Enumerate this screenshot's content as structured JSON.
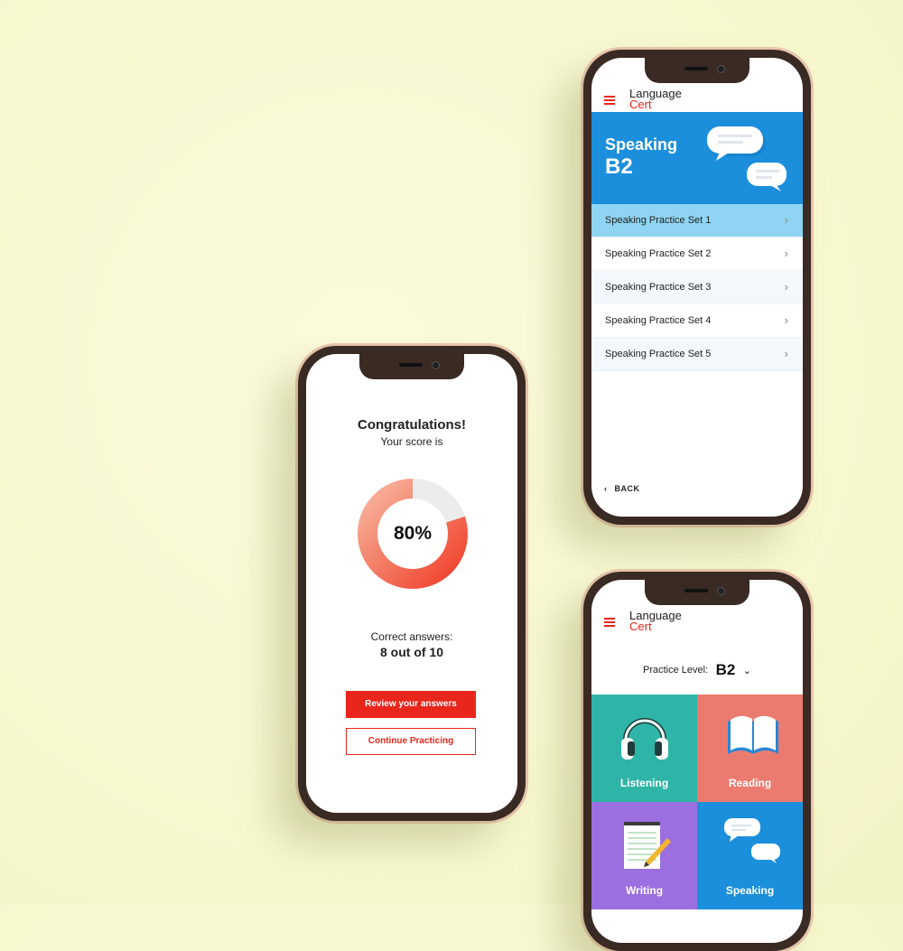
{
  "score_screen": {
    "heading": "Congratulations!",
    "subheading": "Your score is",
    "score_percent": 80,
    "score_text": "80%",
    "correct_label": "Correct answers:",
    "correct_value": "8 out of 10",
    "review_button": "Review your answers",
    "continue_button": "Continue Practicing",
    "accent_color": "#e8261c"
  },
  "brand": {
    "line1": "Language",
    "line2": "Cert"
  },
  "speaking_screen": {
    "title": "Speaking",
    "level": "B2",
    "items": [
      {
        "label": "Speaking Practice Set 1",
        "active": true
      },
      {
        "label": "Speaking Practice Set 2",
        "active": false
      },
      {
        "label": "Speaking Practice Set 3",
        "active": false
      },
      {
        "label": "Speaking Practice Set 4",
        "active": false
      },
      {
        "label": "Speaking Practice Set 5",
        "active": false
      }
    ],
    "back_label": "BACK",
    "banner_color": "#1b8fdc"
  },
  "home_screen": {
    "level_label": "Practice Level:",
    "level_value": "B2",
    "tiles": [
      {
        "label": "Listening",
        "color": "#2fb5a8",
        "icon": "headphones-icon"
      },
      {
        "label": "Reading",
        "color": "#ec7b6f",
        "icon": "book-icon"
      },
      {
        "label": "Writing",
        "color": "#9b6fe0",
        "icon": "notepad-icon"
      },
      {
        "label": "Speaking",
        "color": "#1b8fdc",
        "icon": "speech-bubbles-icon"
      }
    ]
  }
}
